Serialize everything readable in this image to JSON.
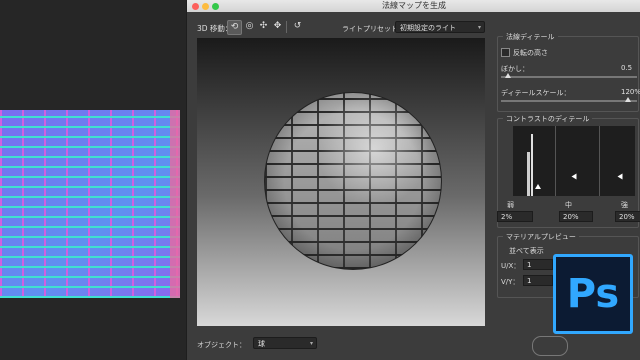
{
  "dialog": {
    "title": "法線マップを生成"
  },
  "toolbar": {
    "label": "3D 移動：",
    "tools": [
      "rotate-tool-icon",
      "roll-tool-icon",
      "pan-tool-icon",
      "slide-tool-icon",
      "reset-view-icon"
    ],
    "light_preset_label": "ライトプリセット：",
    "light_preset_value": "初期設定のライト"
  },
  "object": {
    "label": "オブジェクト：",
    "value": "球"
  },
  "normal_detail": {
    "title": "法線ディテール",
    "invert_height_label": "反転の高さ",
    "blur_label": "ぼかし：",
    "blur_value": "0.5",
    "detail_scale_label": "ディテールスケール：",
    "detail_scale_value": "120%"
  },
  "contrast_detail": {
    "title": "コントラストのディテール",
    "low_label": "弱",
    "mid_label": "中",
    "high_label": "強",
    "low_value": "2%",
    "mid_value": "20%",
    "high_value": "20%"
  },
  "material_preview": {
    "title": "マテリアルプレビュー",
    "tile_label": "並べて表示",
    "ux_label": "U/X：",
    "ux_value": "1",
    "vy_label": "V/Y：",
    "vy_value": "1"
  },
  "app_logo": {
    "text": "Ps",
    "color": "#31a8ff",
    "background": "#0c1b33"
  },
  "colors": {
    "accent": "#31a8ff",
    "dialog_bg": "#3c3c3c"
  }
}
